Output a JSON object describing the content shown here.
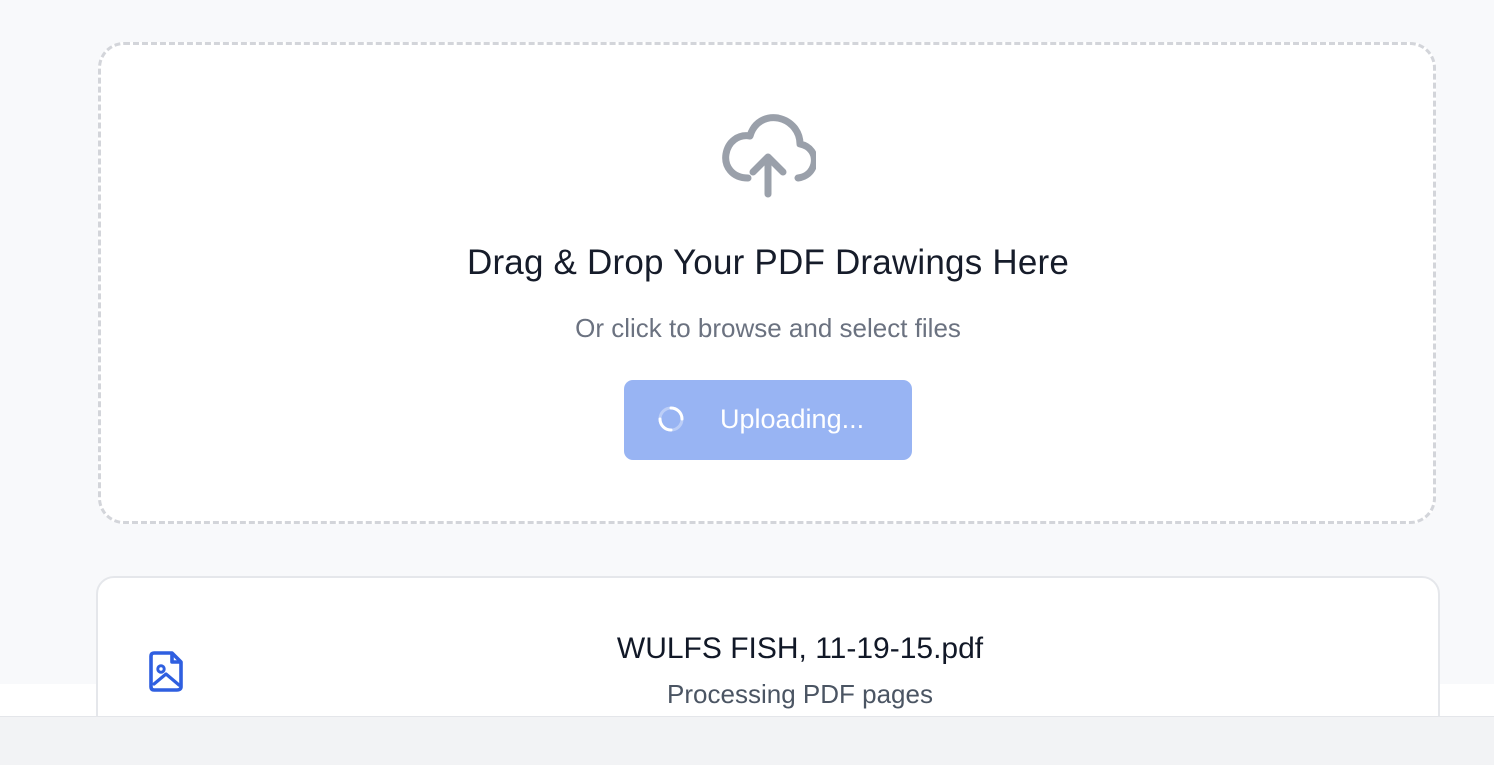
{
  "upload": {
    "title": "Drag & Drop Your PDF Drawings Here",
    "subtitle": "Or click to browse and select files",
    "button_label": "Uploading...",
    "icon": "cloud-upload-icon",
    "spinner_icon": "loading-spinner-icon"
  },
  "file": {
    "name": "WULFS FISH, 11-19-15.pdf",
    "status": "Processing PDF pages",
    "icon": "file-image-icon"
  },
  "colors": {
    "accent": "#2f5fe0",
    "button_disabled": "#98b4f3",
    "icon_gray": "#9ca3af"
  }
}
